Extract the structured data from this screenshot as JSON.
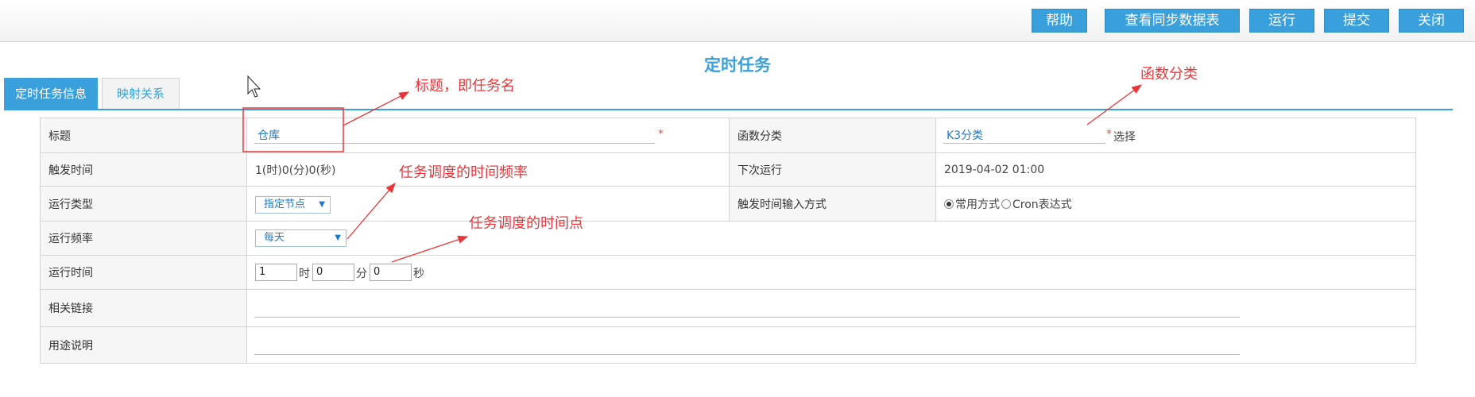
{
  "toolbar": {
    "help": "帮助",
    "view_sync_table": "查看同步数据表",
    "run": "运行",
    "submit": "提交",
    "close": "关闭"
  },
  "page": {
    "title": "定时任务"
  },
  "tabs": [
    {
      "label": "定时任务信息",
      "active": true
    },
    {
      "label": "映射关系",
      "active": false
    }
  ],
  "form": {
    "title_label": "标题",
    "title_value": "仓库",
    "required_mark": "*",
    "func_category_label": "函数分类",
    "func_category_value": "K3分类",
    "select_link": "选择",
    "trigger_time_label": "触发时间",
    "trigger_time_value": "1(时)0(分)0(秒)",
    "next_run_label": "下次运行",
    "next_run_value": "2019-04-02 01:00",
    "run_type_label": "运行类型",
    "run_type_value": "指定节点",
    "trigger_input_label": "触发时间输入方式",
    "trigger_input_options": [
      "常用方式",
      "Cron表达式"
    ],
    "trigger_input_selected": "常用方式",
    "run_freq_label": "运行频率",
    "run_freq_value": "每天",
    "run_time_label": "运行时间",
    "hour_value": "1",
    "hour_unit": "时",
    "minute_value": "0",
    "minute_unit": "分",
    "second_value": "0",
    "second_unit": "秒",
    "related_link_label": "相关链接",
    "related_link_value": "",
    "usage_label": "用途说明",
    "usage_value": ""
  },
  "annotations": {
    "title_note": "标题，即任务名",
    "func_note": "函数分类",
    "freq_note": "任务调度的时间频率",
    "time_note": "任务调度的时间点"
  },
  "colors": {
    "accent": "#3aa0dc",
    "annotation": "#e8373a"
  }
}
